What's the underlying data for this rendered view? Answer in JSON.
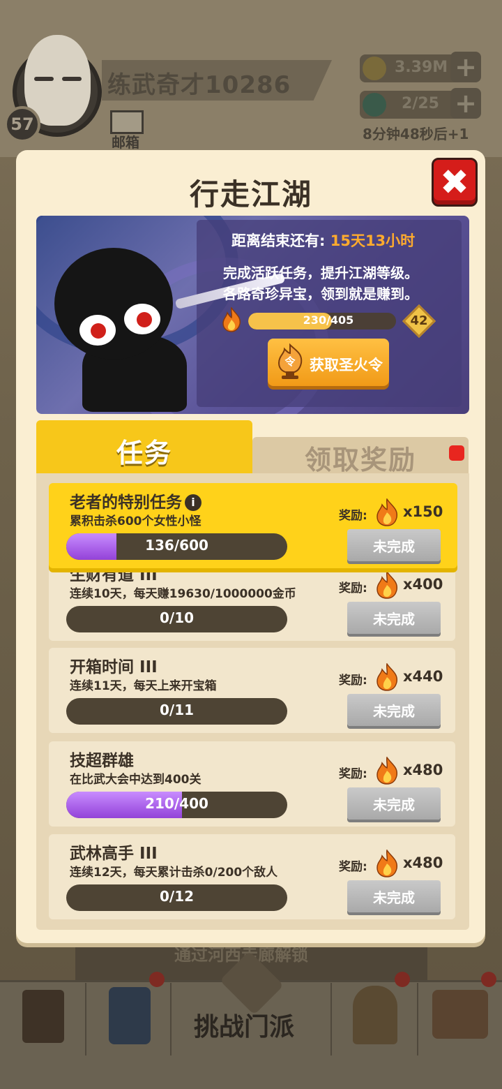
{
  "hud": {
    "player_level": "57",
    "player_name": "练武奇才10286",
    "mail_label": "邮箱",
    "gold": "3.39M",
    "energy": "2/25",
    "energy_timer": "8分钟48秒后+1",
    "plus_label": "+"
  },
  "bottom": {
    "hint_text": "通过河西走廊解锁",
    "center_label": "挑战门派",
    "nav_icons": [
      "task-scroll-icon",
      "cultivate-book-icon",
      "crossed-swords-icon",
      "armor-icon",
      "collect-house-icon"
    ]
  },
  "modal": {
    "title": "行走江湖",
    "close_label": "✖",
    "banner": {
      "countdown_label": "距离结束还有:",
      "countdown_value": "15天13小时",
      "desc_line1": "完成活跃任务，提升江湖等级。",
      "desc_line2": "各路奇珍异宝，领到就是赚到。",
      "xp_text": "230/405",
      "xp_fraction": 0.568,
      "level": "42",
      "get_button": "获取圣火令",
      "get_icon_char": "令"
    },
    "tabs": {
      "active": "任务",
      "inactive": "领取奖励"
    },
    "reward_label": "奖励:",
    "tasks": [
      {
        "title": "老者的特别任务",
        "desc": "累积击杀600个女性小怪",
        "progress_text": "136/600",
        "progress": 0.227,
        "reward": "x150",
        "status": "未完成"
      },
      {
        "title": "生财有道 III",
        "desc": "连续10天，每天赚19630/1000000金币",
        "progress_text": "0/10",
        "progress": 0,
        "reward": "x400",
        "status": "未完成"
      },
      {
        "title": "开箱时间 III",
        "desc": "连续11天，每天上来开宝箱",
        "progress_text": "0/11",
        "progress": 0,
        "reward": "x440",
        "status": "未完成"
      },
      {
        "title": "技超群雄",
        "desc": "在比武大会中达到400关",
        "progress_text": "210/400",
        "progress": 0.525,
        "reward": "x480",
        "status": "未完成"
      },
      {
        "title": "武林高手 III",
        "desc": "连续12天，每天累计击杀0/200个敌人",
        "progress_text": "0/12",
        "progress": 0,
        "reward": "x480",
        "status": "未完成"
      }
    ],
    "colors": {
      "accent_yellow": "#f7c71a",
      "close_red": "#d51d1a",
      "progress_purple": "#9342d8",
      "countdown_orange": "#ffab2d"
    }
  }
}
